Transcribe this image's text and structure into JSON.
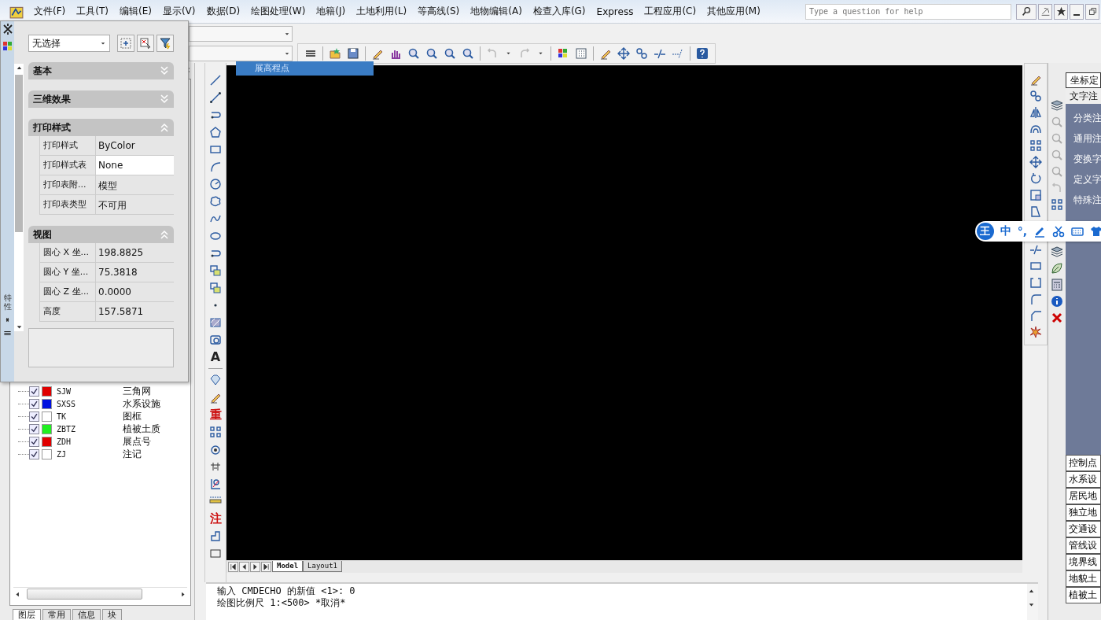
{
  "menu_bar": {
    "items": [
      "文件(F)",
      "工具(T)",
      "编辑(E)",
      "显示(V)",
      "数据(D)",
      "绘图处理(W)",
      "地籍(J)",
      "土地利用(L)",
      "等高线(S)",
      "地物编辑(A)",
      "检查入库(G)",
      "Express",
      "工程应用(C)",
      "其他应用(M)"
    ],
    "help_search": {
      "placeholder": "Type a question for help"
    }
  },
  "tooltip": "展高程点",
  "properties": {
    "title": "特性",
    "selection": "无选择",
    "sections": [
      {
        "title": "基本",
        "expanded": false
      },
      {
        "title": "三维效果",
        "expanded": false
      },
      {
        "title": "打印样式",
        "expanded": true,
        "rows": [
          {
            "label": "打印样式",
            "value": "ByColor",
            "selected": false
          },
          {
            "label": "打印样式表",
            "value": "None",
            "selected": true
          },
          {
            "label": "打印表附...",
            "value": "模型",
            "selected": false
          },
          {
            "label": "打印表类型",
            "value": "不可用",
            "selected": false
          }
        ]
      },
      {
        "title": "视图",
        "expanded": true,
        "rows": [
          {
            "label": "圆心 X 坐...",
            "value": "198.8825",
            "selected": false
          },
          {
            "label": "圆心 Y 坐...",
            "value": "75.3818",
            "selected": false
          },
          {
            "label": "圆心 Z 坐...",
            "value": "0.0000",
            "selected": false
          },
          {
            "label": "高度",
            "value": "157.5871",
            "selected": false
          }
        ]
      }
    ]
  },
  "layers": [
    {
      "name": "SJW",
      "description": "三角网",
      "visible": true,
      "color": "#e00000"
    },
    {
      "name": "SXSS",
      "description": "水系设施",
      "visible": true,
      "color": "#0010e0"
    },
    {
      "name": "TK",
      "description": "图框",
      "visible": true,
      "color": "#ffffff"
    },
    {
      "name": "ZBTZ",
      "description": "植被土质",
      "visible": true,
      "color": "#20f020"
    },
    {
      "name": "ZDH",
      "description": "展点号",
      "visible": true,
      "color": "#e00000"
    },
    {
      "name": "ZJ",
      "description": "注记",
      "visible": true,
      "color": "#ffffff"
    }
  ],
  "layer_panel_tabs": [
    {
      "label": "图层",
      "selected": true
    },
    {
      "label": "常用",
      "selected": false
    },
    {
      "label": "信息",
      "selected": false
    },
    {
      "label": "块",
      "selected": false
    }
  ],
  "draw_toolbar_glyphs": [
    "A",
    "重",
    "注"
  ],
  "drawing_tabs": [
    {
      "label": "Model",
      "selected": true
    },
    {
      "label": "Layout1",
      "selected": false
    }
  ],
  "command_lines": [
    "输入 CMDECHO 的新值 <1>: 0",
    "绘图比例尺 1:<500> *取消*"
  ],
  "right_panel": {
    "header": "坐标定",
    "group": "文字注",
    "items": [
      "分类注",
      "通用注",
      "变换字",
      "定义字",
      "特殊注"
    ],
    "categories": [
      "控制点",
      "水系设",
      "居民地",
      "独立地",
      "交通设",
      "管线设",
      "境界线",
      "地貌土",
      "植被土"
    ]
  },
  "ime_bar": {
    "logo": "王",
    "mode": "中",
    "punctuation": "°,"
  }
}
